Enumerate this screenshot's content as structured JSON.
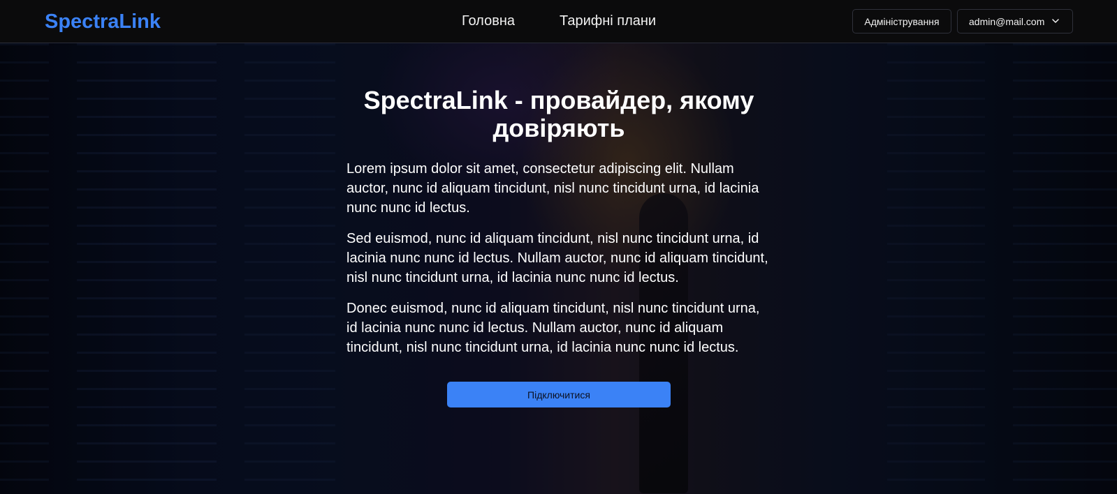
{
  "header": {
    "logo": "SpectraLink",
    "nav": [
      {
        "label": "Головна"
      },
      {
        "label": "Тарифні плани"
      }
    ],
    "admin_button": "Адміністрування",
    "user_menu": {
      "email": "admin@mail.com",
      "icon": "chevron-down-icon"
    }
  },
  "hero": {
    "title": "SpectraLink - провайдер, якому довіряють",
    "paragraphs": [
      "Lorem ipsum dolor sit amet, consectetur adipiscing elit. Nullam auctor, nunc id aliquam tincidunt, nisl nunc tincidunt urna, id lacinia nunc nunc id lectus.",
      "Sed euismod, nunc id aliquam tincidunt, nisl nunc tincidunt urna, id lacinia nunc nunc id lectus. Nullam auctor, nunc id aliquam tincidunt, nisl nunc tincidunt urna, id lacinia nunc nunc id lectus.",
      "Donec euismod, nunc id aliquam tincidunt, nisl nunc tincidunt urna, id lacinia nunc nunc id lectus. Nullam auctor, nunc id aliquam tincidunt, nisl nunc tincidunt urna, id lacinia nunc nunc id lectus."
    ],
    "cta": "Підключитися"
  },
  "colors": {
    "accent": "#3b82f6",
    "header_bg": "#0b0b0c",
    "text": "#ffffff"
  }
}
